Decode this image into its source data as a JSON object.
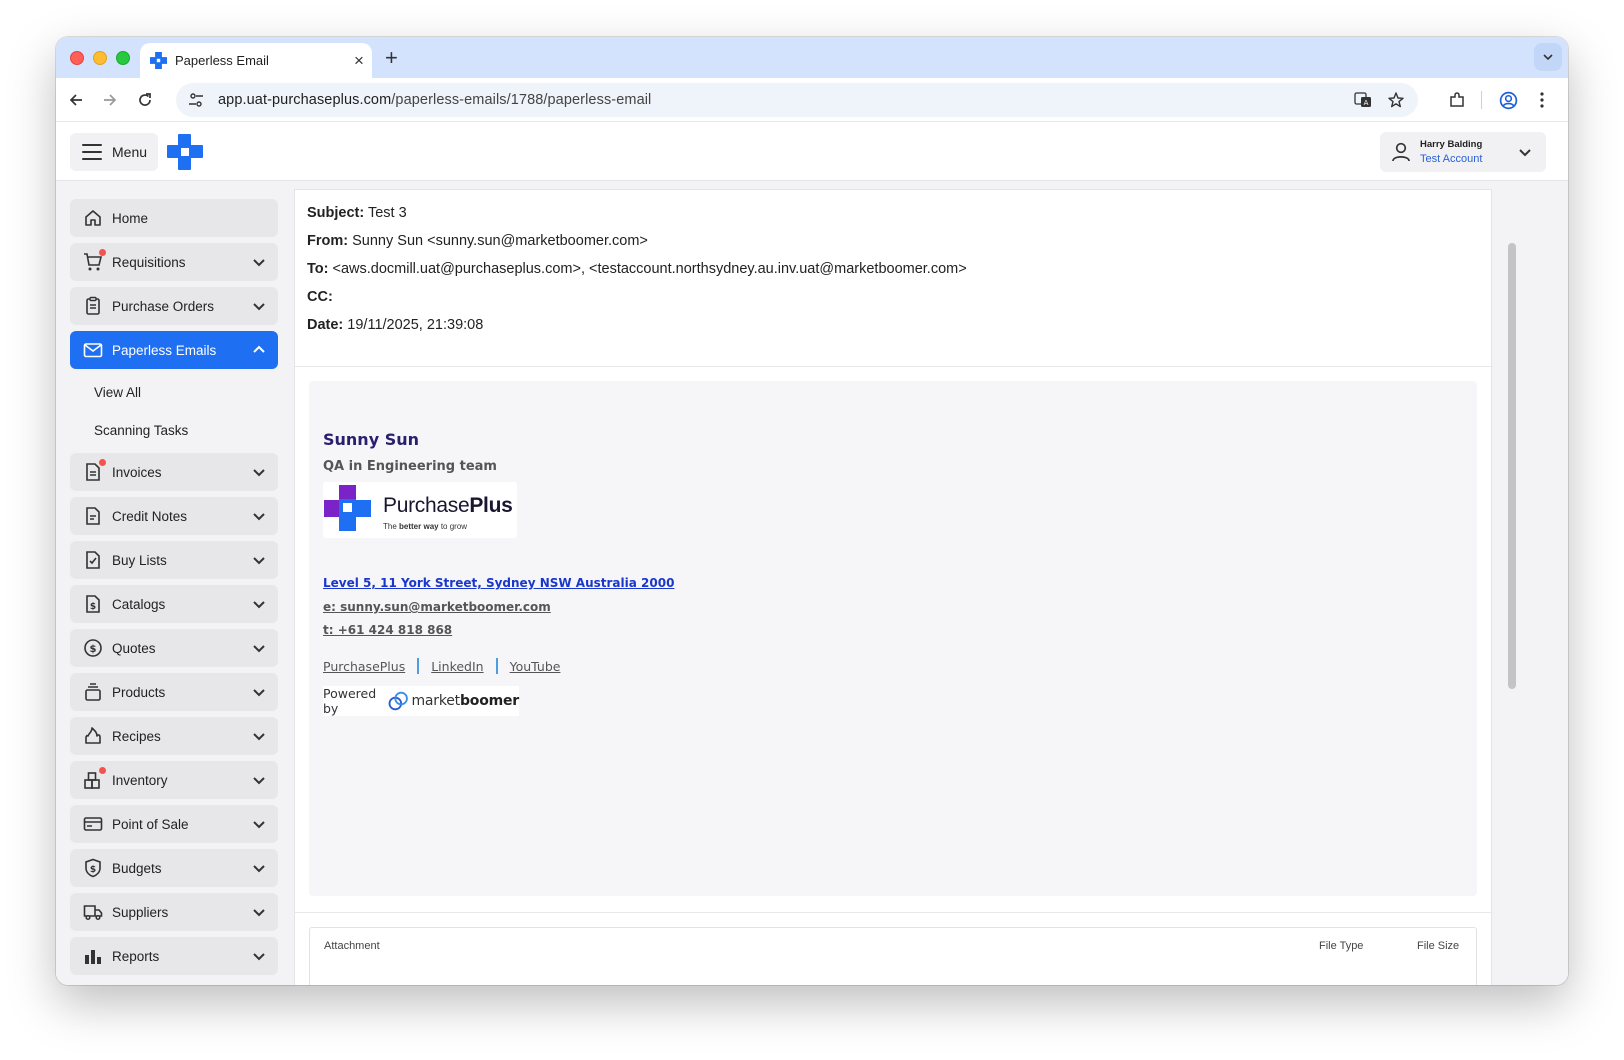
{
  "browser": {
    "tab_title": "Paperless Email",
    "new_tab": "+",
    "close_tab": "×",
    "url_host": "app.uat-purchaseplus.com",
    "url_path": "/paperless-emails/1788/paperless-email"
  },
  "header": {
    "menu_label": "Menu",
    "user_name": "Harry Balding",
    "user_account": "Test Account"
  },
  "sidebar": {
    "items": [
      {
        "label": "Home",
        "icon": "home-icon"
      },
      {
        "label": "Requisitions",
        "icon": "cart-icon",
        "badge": true
      },
      {
        "label": "Purchase Orders",
        "icon": "clipboard-icon"
      },
      {
        "label": "Paperless Emails",
        "icon": "mail-icon",
        "active": true
      },
      {
        "label": "Invoices",
        "icon": "invoice-icon",
        "badge": true
      },
      {
        "label": "Credit Notes",
        "icon": "document-icon"
      },
      {
        "label": "Buy Lists",
        "icon": "checklist-icon"
      },
      {
        "label": "Catalogs",
        "icon": "catalog-dollar-icon"
      },
      {
        "label": "Quotes",
        "icon": "dollar-circle-icon"
      },
      {
        "label": "Products",
        "icon": "products-stack-icon"
      },
      {
        "label": "Recipes",
        "icon": "flame-icon"
      },
      {
        "label": "Inventory",
        "icon": "boxes-icon",
        "badge": true
      },
      {
        "label": "Point of Sale",
        "icon": "card-icon"
      },
      {
        "label": "Budgets",
        "icon": "shield-dollar-icon"
      },
      {
        "label": "Suppliers",
        "icon": "truck-icon"
      },
      {
        "label": "Reports",
        "icon": "bar-chart-icon"
      }
    ],
    "sub_items": [
      "View All",
      "Scanning Tasks"
    ]
  },
  "email": {
    "subject_label": "Subject:",
    "subject": "Test 3",
    "from_label": "From:",
    "from": "Sunny Sun <sunny.sun@marketboomer.com>",
    "to_label": "To:",
    "to": "<aws.docmill.uat@purchaseplus.com>, <testaccount.northsydney.au.inv.uat@marketboomer.com>",
    "cc_label": "CC:",
    "cc": "",
    "date_label": "Date:",
    "date": "19/11/2025, 21:39:08"
  },
  "signature": {
    "name": "Sunny Sun",
    "role": "QA in Engineering team",
    "logo_word_light": "Purchase",
    "logo_word_bold": "Plus",
    "logo_tag_pre": "The ",
    "logo_tag_bold": "better way",
    "logo_tag_post": " to grow",
    "address": "Level 5, 11 York Street, Sydney NSW Australia 2000",
    "email": "e: sunny.sun@marketboomer.com",
    "phone": "t: +61 424 818 868",
    "links": [
      "PurchasePlus",
      "LinkedIn",
      "YouTube"
    ],
    "powered_by": "Powered by",
    "mb_light": "market",
    "mb_bold": "boomer"
  },
  "attachments": {
    "headers": [
      "Attachment",
      "File Type",
      "File Size"
    ]
  },
  "colors": {
    "accent": "#1e6ff2",
    "tabstrip": "#d3e3fd",
    "badge": "#f2534f",
    "sig_name": "#2a1f6f",
    "link_blue": "#1a37cc"
  }
}
